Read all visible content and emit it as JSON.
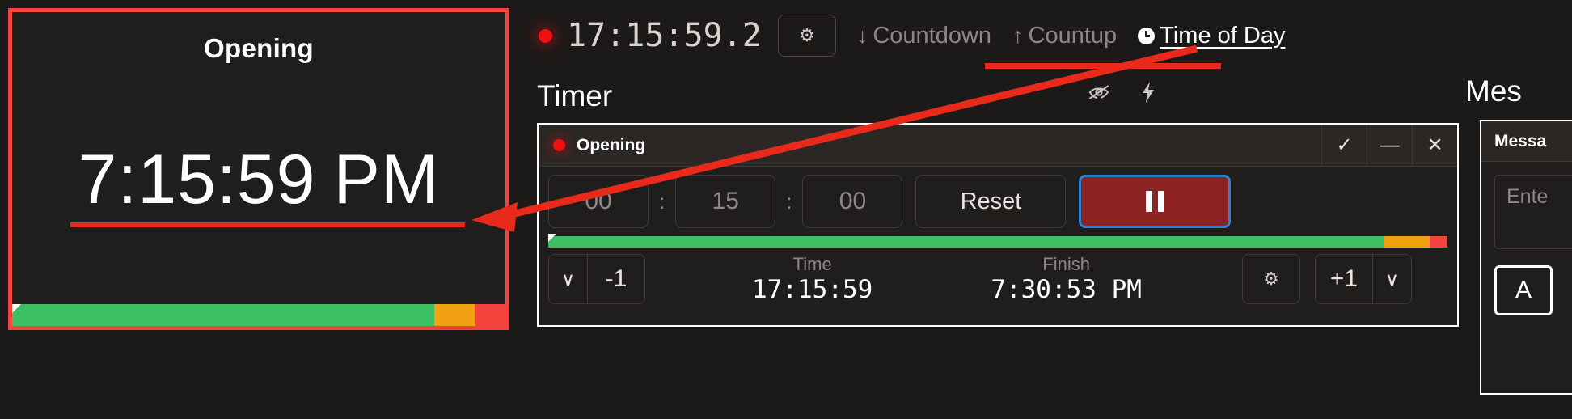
{
  "preview": {
    "title": "Opening",
    "time": "7:15:59",
    "ampm": "PM",
    "progress": {
      "green_pct": 85.5,
      "orange_pct": 8.5,
      "red_pct": 6.0,
      "marker_pct": 0
    }
  },
  "topbar": {
    "rec_dot": "record-dot",
    "clock": "17:15:59.2",
    "settings_icon": "⚙",
    "modes": [
      {
        "label": "Countdown",
        "icon": "↓",
        "active": false
      },
      {
        "label": "Countup",
        "icon": "↑",
        "active": false
      },
      {
        "label": "Time of Day",
        "icon": "clock-icon",
        "active": true
      }
    ]
  },
  "timer_section": {
    "title": "Timer",
    "hide_icon": "ὄ1",
    "bolt_icon": "⚡"
  },
  "message_section": {
    "title": "Mes",
    "head_label": "Messa",
    "textarea_value": "Ente",
    "a_button": "A"
  },
  "timer_card": {
    "name": "Opening",
    "head_buttons": [
      {
        "name": "confirm",
        "glyph": "✓"
      },
      {
        "name": "minimize",
        "glyph": "—"
      },
      {
        "name": "close",
        "glyph": "✕"
      }
    ],
    "hours": "00",
    "minutes": "15",
    "seconds": "00",
    "colon": ":",
    "reset_label": "Reset",
    "pause_label": "pause",
    "progress": {
      "green_pct": 93.0,
      "orange_pct": 5.0,
      "red_pct": 2.0,
      "marker_pct": 0
    },
    "minus_chevron": "∨",
    "minus_value": "-1",
    "time_label": "Time",
    "time_value": "17:15:59",
    "finish_label": "Finish",
    "finish_value": "7:30:53  PM",
    "settings_icon": "⚙",
    "plus_value": "+1",
    "plus_chevron": "∨"
  },
  "colors": {
    "accent_red": "#e8291c",
    "border_red": "#f4433c",
    "progress_green": "#3fbf63",
    "progress_orange": "#f0a010",
    "progress_red": "#f4433c",
    "pause_bg": "#8c2222",
    "focus_blue": "#2b82d4",
    "background": "#1c1a18",
    "panel": "#201e1c"
  }
}
